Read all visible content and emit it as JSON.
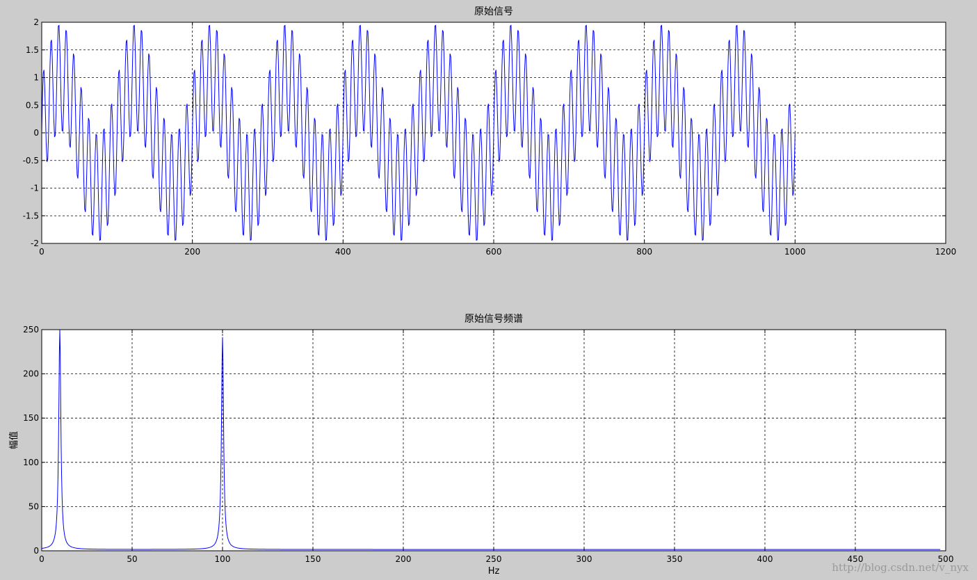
{
  "chart_data": [
    {
      "type": "line",
      "title": "原始信号",
      "xlabel": "",
      "ylabel": "",
      "xlim": [
        0,
        1200
      ],
      "ylim": [
        -2,
        2
      ],
      "xticks": [
        "0",
        "200",
        "400",
        "600",
        "800",
        "1000",
        "1200"
      ],
      "yticks": [
        "-2",
        "-1.5",
        "-1",
        "-0.5",
        "0",
        "0.5",
        "1",
        "1.5",
        "2"
      ],
      "grid": true,
      "series": [
        {
          "color": "#0000ff",
          "x_range": [
            0,
            1000
          ],
          "components": [
            {
              "amplitude": 1,
              "cycles_per_unit": 0.01
            },
            {
              "amplitude": 1,
              "cycles_per_unit": 0.1
            }
          ]
        }
      ]
    },
    {
      "type": "line",
      "title": "原始信号频谱",
      "xlabel": "Hz",
      "ylabel": "幅值",
      "xlim": [
        0,
        500
      ],
      "ylim": [
        0,
        250
      ],
      "xticks": [
        "0",
        "50",
        "100",
        "150",
        "200",
        "250",
        "300",
        "350",
        "400",
        "450",
        "500"
      ],
      "yticks": [
        "0",
        "50",
        "100",
        "150",
        "200",
        "250"
      ],
      "grid": true,
      "series": [
        {
          "color": "#0000ff",
          "x_range": [
            0,
            497
          ],
          "peaks": [
            {
              "x": 10,
              "y": 250
            },
            {
              "x": 100,
              "y": 240
            }
          ],
          "baseline": 1.5
        }
      ]
    }
  ],
  "watermark": "http://blog.csdn.net/v_nyx"
}
